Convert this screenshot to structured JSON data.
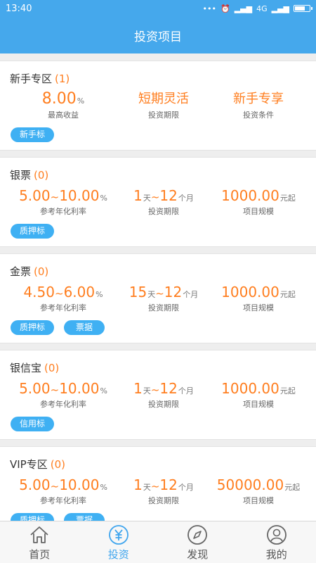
{
  "status": {
    "time": "13:40",
    "network": "4G"
  },
  "header": {
    "title": "投资项目"
  },
  "cards": [
    {
      "title": "新手专区",
      "count": "(1)",
      "col1": {
        "value": "8.00",
        "unit": "%",
        "label": "最高收益"
      },
      "col2": {
        "value": "短期灵活",
        "label": "投资期限"
      },
      "col3": {
        "value": "新手专享",
        "label": "投资条件"
      },
      "tags": [
        "新手标"
      ]
    },
    {
      "title": "银票",
      "count": "(0)",
      "col1": {
        "from": "5.00",
        "to": "10.00",
        "unit": "%",
        "label": "参考年化利率"
      },
      "col2": {
        "from": "1",
        "from_unit": "天",
        "to": "12",
        "to_unit": "个月",
        "label": "投资期限"
      },
      "col3": {
        "value": "1000.00",
        "unit": "元起",
        "label": "项目规模"
      },
      "tags": [
        "质押标"
      ]
    },
    {
      "title": "金票",
      "count": "(0)",
      "col1": {
        "from": "4.50",
        "to": "6.00",
        "unit": "%",
        "label": "参考年化利率"
      },
      "col2": {
        "from": "15",
        "from_unit": "天",
        "to": "12",
        "to_unit": "个月",
        "label": "投资期限"
      },
      "col3": {
        "value": "1000.00",
        "unit": "元起",
        "label": "项目规模"
      },
      "tags": [
        "质押标",
        "票据"
      ]
    },
    {
      "title": "银信宝",
      "count": "(0)",
      "col1": {
        "from": "5.00",
        "to": "10.00",
        "unit": "%",
        "label": "参考年化利率"
      },
      "col2": {
        "from": "1",
        "from_unit": "天",
        "to": "12",
        "to_unit": "个月",
        "label": "投资期限"
      },
      "col3": {
        "value": "1000.00",
        "unit": "元起",
        "label": "项目规模"
      },
      "tags": [
        "信用标"
      ]
    },
    {
      "title": "VIP专区",
      "count": "(0)",
      "col1": {
        "from": "5.00",
        "to": "10.00",
        "unit": "%",
        "label": "参考年化利率"
      },
      "col2": {
        "from": "1",
        "from_unit": "天",
        "to": "12",
        "to_unit": "个月",
        "label": "投资期限"
      },
      "col3": {
        "value": "50000.00",
        "unit": "元起",
        "label": "项目规模"
      },
      "tags": [
        "质押标",
        "票据"
      ]
    }
  ],
  "tabbar": {
    "home": "首页",
    "invest": "投资",
    "discover": "发现",
    "mine": "我的"
  },
  "colors": {
    "primary": "#45a8ec",
    "accent": "#ff7e1f",
    "tag": "#3fb0f3"
  }
}
